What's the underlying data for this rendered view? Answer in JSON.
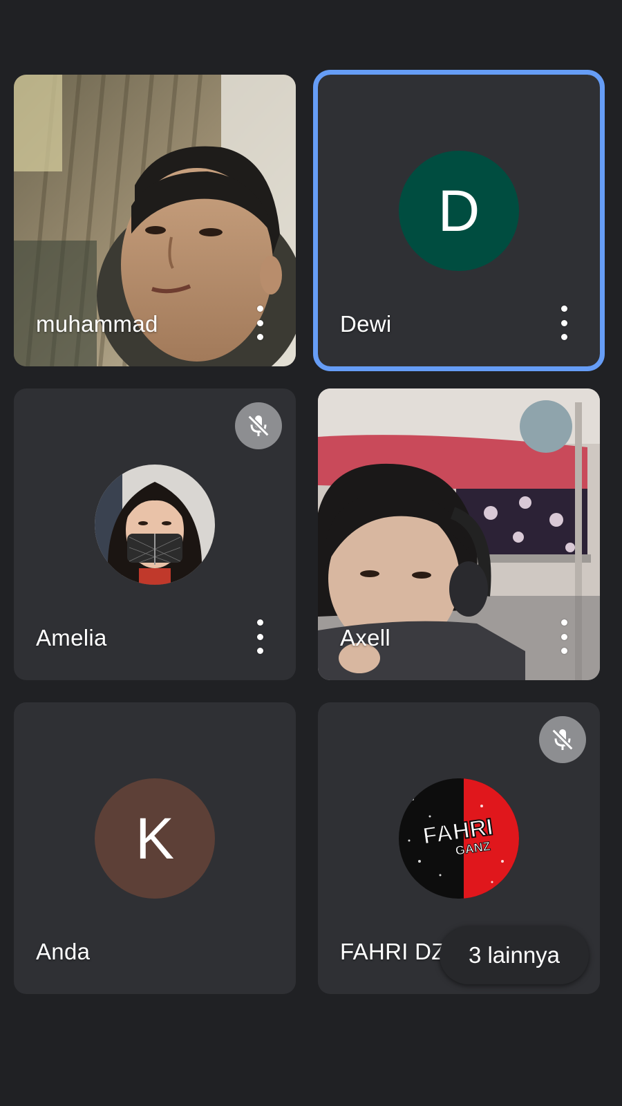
{
  "participants": [
    {
      "name": "muhammad",
      "type": "video",
      "muted": false,
      "active": false
    },
    {
      "name": "Dewi",
      "type": "initial",
      "initial": "D",
      "avatar_color": "#004d40",
      "muted": false,
      "active": true
    },
    {
      "name": "Amelia",
      "type": "photo-avatar",
      "muted": true,
      "active": false
    },
    {
      "name": "Axell",
      "type": "video",
      "muted": false,
      "active": false
    },
    {
      "name": "Anda",
      "type": "initial",
      "initial": "K",
      "avatar_color": "#5d4037",
      "muted": false,
      "active": false
    },
    {
      "name": "FAHRI DZ...",
      "type": "logo-avatar",
      "logo_text_1": "FAHRI",
      "logo_text_2": "GANZ",
      "muted": true,
      "active": false
    }
  ],
  "others_button": {
    "label": "3 lainnya"
  },
  "colors": {
    "background": "#202124",
    "tile": "#2f3034",
    "active_border": "#669df6",
    "mute_badge": "#8d8e91"
  },
  "icons": {
    "more": "more-vert-icon",
    "muted": "mic-off-icon"
  }
}
